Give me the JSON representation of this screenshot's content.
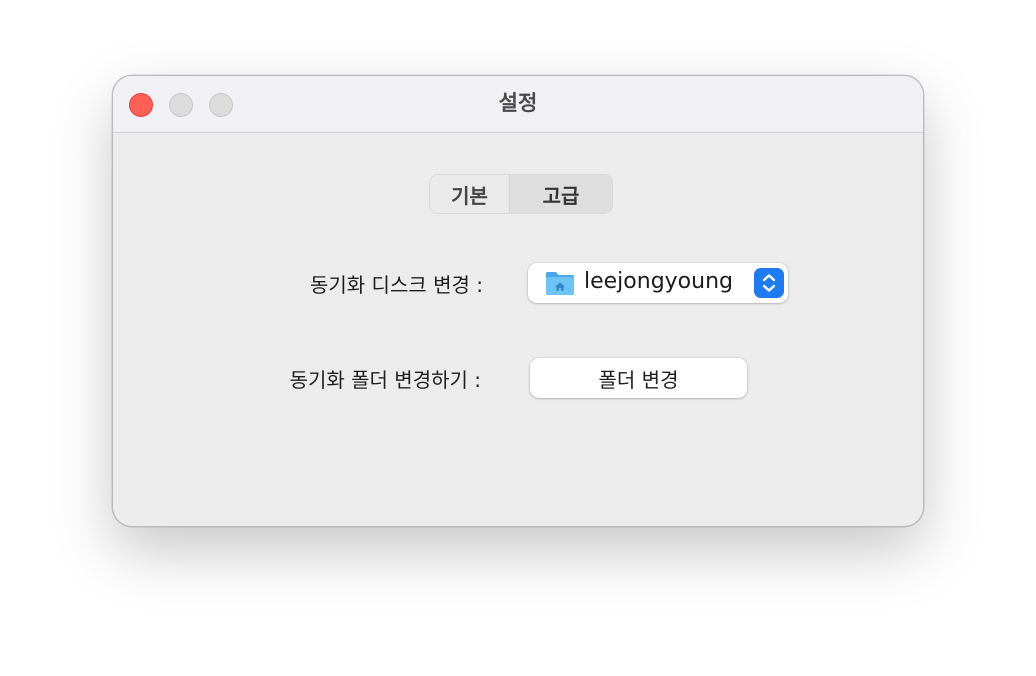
{
  "window": {
    "title": "설정"
  },
  "tabs": [
    {
      "label": "기본",
      "selected": false
    },
    {
      "label": "고급",
      "selected": true
    }
  ],
  "settings": {
    "disk_label": "동기화 디스크 변경 :",
    "disk_value": "leejongyoung",
    "disk_icon": "home-folder-icon",
    "folder_label": "동기화 폴더 변경하기 :",
    "folder_button": "폴더 변경"
  },
  "colors": {
    "close": "#fe5f57",
    "accent": "#1f7bf2",
    "folder": "#5cb7f2"
  }
}
